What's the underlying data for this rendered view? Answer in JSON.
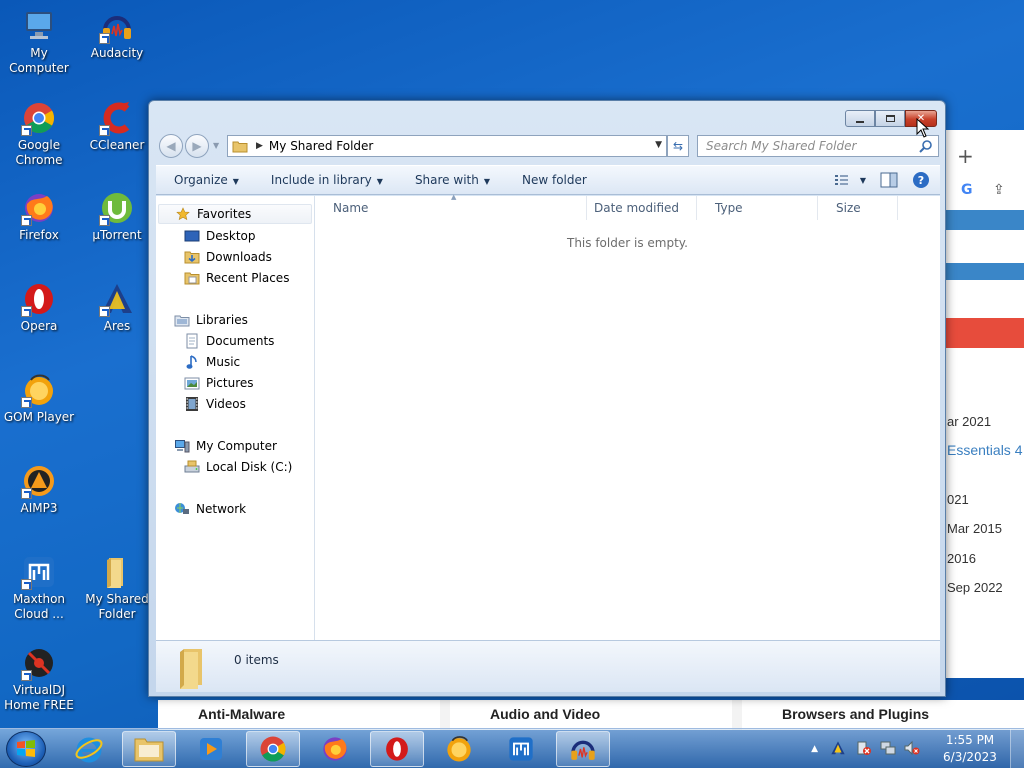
{
  "desktop": {
    "icons": [
      {
        "label": "My Computer"
      },
      {
        "label": "Audacity"
      },
      {
        "label": "Google Chrome"
      },
      {
        "label": "CCleaner"
      },
      {
        "label": "Firefox"
      },
      {
        "label": "µTorrent"
      },
      {
        "label": "Opera"
      },
      {
        "label": "Ares"
      },
      {
        "label": "GOM Player"
      },
      {
        "label": "AIMP3"
      },
      {
        "label": "Maxthon Cloud ..."
      },
      {
        "label": "My Shared Folder"
      },
      {
        "label": "VirtualDJ Home FREE"
      }
    ]
  },
  "background_browser": {
    "plus": "+",
    "rows": [
      "ar 2021",
      "Essentials 4",
      "021",
      "Mar 2015",
      "2016",
      "Sep 2022"
    ],
    "categories": [
      "Anti-Malware",
      "Audio and Video",
      "Browsers and Plugins"
    ]
  },
  "explorer": {
    "address": {
      "crumb": "My Shared Folder"
    },
    "search": {
      "placeholder": "Search My Shared Folder"
    },
    "toolbar": {
      "organize": "Organize",
      "include_in_library": "Include in library",
      "share_with": "Share with",
      "new_folder": "New folder"
    },
    "nav": {
      "favorites": "Favorites",
      "desktop": "Desktop",
      "downloads": "Downloads",
      "recent_places": "Recent Places",
      "libraries": "Libraries",
      "documents": "Documents",
      "music": "Music",
      "pictures": "Pictures",
      "videos": "Videos",
      "my_computer": "My Computer",
      "local_disk": "Local Disk (C:)",
      "network": "Network"
    },
    "columns": {
      "name": "Name",
      "date_modified": "Date modified",
      "type": "Type",
      "size": "Size"
    },
    "empty_message": "This folder is empty.",
    "details": {
      "item_count": "0 items"
    }
  },
  "taskbar": {
    "apps": [
      "Internet Explorer",
      "Windows Explorer",
      "Media Player",
      "Google Chrome",
      "Firefox",
      "Opera",
      "GOM Player",
      "Maxthon",
      "Audacity"
    ],
    "clock": {
      "time": "1:55 PM",
      "date": "6/3/2023"
    }
  },
  "colors": {
    "close_button": "#c8412a",
    "selection": "#3a86c8",
    "accent_red": "#e74c3c"
  }
}
